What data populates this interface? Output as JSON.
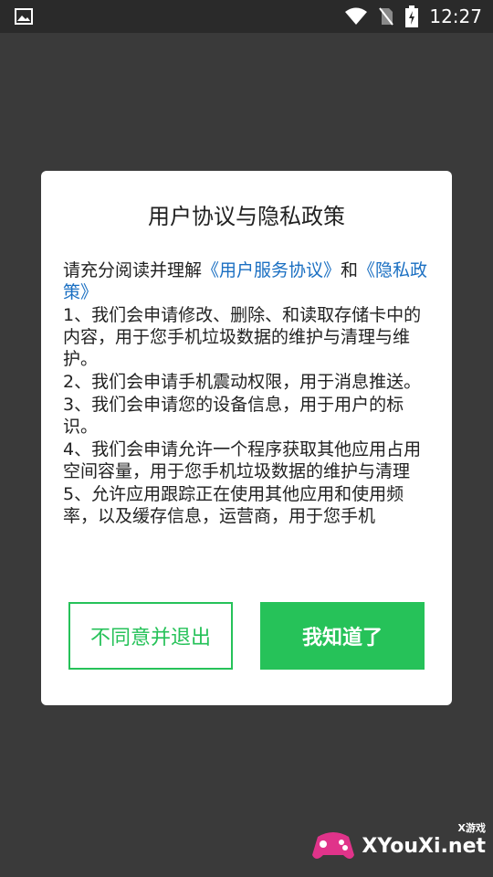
{
  "status_bar": {
    "time": "12:27",
    "icons": [
      "image-icon",
      "wifi-icon",
      "no-sim-icon",
      "battery-charging-icon"
    ]
  },
  "dialog": {
    "title": "用户协议与隐私政策",
    "intro": {
      "prefix": "请充分阅读并理解",
      "link1": "《用户服务协议》",
      "middle": "和",
      "link2": "《隐私政策》"
    },
    "items": [
      "1、我们会申请修改、删除、和读取存储卡中的内容，用于您手机垃圾数据的维护与清理与维护。",
      "2、我们会申请手机震动权限，用于消息推送。",
      "3、我们会申请您的设备信息，用于用户的标识。",
      "4、我们会申请允许一个程序获取其他应用占用空间容量，用于您手机垃圾数据的维护与清理",
      "5、允许应用跟踪正在使用其他应用和使用频率，以及缓存信息，运营商，用于您手机"
    ],
    "decline_label": "不同意并退出",
    "accept_label": "我知道了"
  },
  "watermark": {
    "brand": "XYouXi.net",
    "tag": "X游戏"
  },
  "colors": {
    "accent": "#26c259",
    "link": "#1a6fc2",
    "overlay": "#3a3a3a"
  }
}
